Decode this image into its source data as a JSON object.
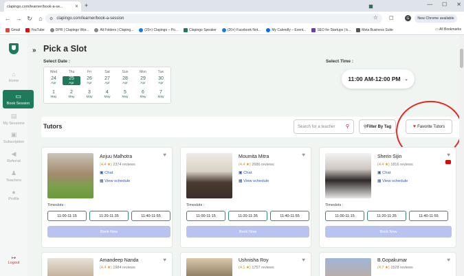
{
  "browser": {
    "tab_title": "clapingo.com/learner/book-a-se...",
    "url": "clapingo.com/learner/book-a-session",
    "new_chrome": "New Chrome available",
    "profile_initial": "G",
    "bookmarks": [
      "Gmail",
      "YouTube",
      "DPR | Clapingo Wor...",
      "All Folders | Claping...",
      "(20+) Clapingo – Po...",
      "Clapingo Speaker",
      "(20+) Facebook Not...",
      "My Calendly – Event...",
      "SEO for Startups | b...",
      "Meta Business Suite"
    ],
    "all_bookmarks": "All Bookmarks"
  },
  "sidebar": {
    "items": [
      "Home",
      "Book Session",
      "My Sessions",
      "Subscription",
      "Referral",
      "Teachers",
      "Profile"
    ],
    "logout": "Logout"
  },
  "page": {
    "title": "Pick a Slot",
    "select_date": "Select Date :",
    "select_time": "Select Time :",
    "time_value": "11:00 AM-12:00 PM",
    "days": [
      "Wed",
      "Thu",
      "Fri",
      "Sat",
      "Sun",
      "Mon",
      "Tue"
    ],
    "dates_row1": [
      {
        "n": "24",
        "m": "Apr"
      },
      {
        "n": "25",
        "m": "Apr"
      },
      {
        "n": "26",
        "m": "Apr"
      },
      {
        "n": "27",
        "m": "Apr"
      },
      {
        "n": "28",
        "m": "Apr"
      },
      {
        "n": "29",
        "m": "Apr"
      },
      {
        "n": "30",
        "m": "Apr"
      }
    ],
    "dates_row2": [
      {
        "n": "1",
        "m": "May"
      },
      {
        "n": "2",
        "m": "May"
      },
      {
        "n": "3",
        "m": "May"
      },
      {
        "n": "4",
        "m": "May"
      },
      {
        "n": "5",
        "m": "May"
      },
      {
        "n": "6",
        "m": "May"
      },
      {
        "n": "7",
        "m": "May"
      }
    ],
    "selected_date": "25 Apr"
  },
  "tutors_bar": {
    "title": "Tutors",
    "search_placeholder": "Search for a teacher",
    "filter": "Filter By Tag",
    "favorite": "Favorite Tutors"
  },
  "tutors": [
    {
      "name": "Anjuu Malhotra",
      "rating": "(4.4 ★)",
      "reviews": "2374 reviews",
      "chat": "Chat",
      "schedule": "View schedule",
      "timeslots_label": "Timeslots :",
      "slots": [
        "11:00-11:15",
        "11:20-11:35",
        "11:40-11:55"
      ],
      "book": "Book Now"
    },
    {
      "name": "Moumita Mitra",
      "rating": "(4.4 ★)",
      "reviews": "2686 reviews",
      "chat": "Chat",
      "schedule": "View schedule",
      "timeslots_label": "Timeslots :",
      "slots": [
        "11:00-11:15",
        "11:20-11:35",
        "11:40-11:55"
      ],
      "book": "Book Now"
    },
    {
      "name": "Sherin Sijin",
      "rating": "(4.4 ★)",
      "reviews": "1816 reviews",
      "chat": "Chat",
      "schedule": "View schedule",
      "timeslots_label": "Timeslots :",
      "slots": [
        "11:00-11:15",
        "11:20-11:35",
        "11:40-11:55"
      ],
      "book": "Book Now"
    },
    {
      "name": "Amandeep Nanda",
      "rating": "(4.4 ★)",
      "reviews": "1984 reviews"
    },
    {
      "name": "Ushnisha Roy",
      "rating": "(4.1 ★)",
      "reviews": "1757 reviews"
    },
    {
      "name": "B.Gopakumar",
      "rating": "(4.7 ★)",
      "reviews": "1528 reviews"
    }
  ]
}
